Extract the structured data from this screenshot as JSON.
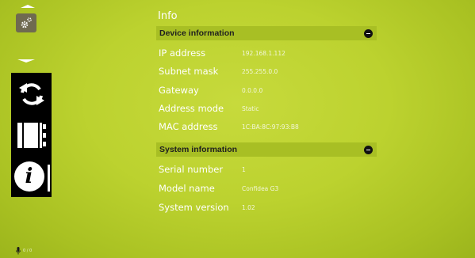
{
  "title": "Info",
  "sidebar": {
    "items": [
      {
        "icon": "gear-icon",
        "selected": false
      },
      {
        "icon": "refresh-icon",
        "selected": false
      },
      {
        "icon": "video-strip-icon",
        "selected": false
      },
      {
        "icon": "info-icon",
        "selected": true
      }
    ]
  },
  "device_section": {
    "label": "Device information",
    "rows": [
      {
        "label": "IP address",
        "value": "192.168.1.112"
      },
      {
        "label": "Subnet mask",
        "value": "255.255.0.0"
      },
      {
        "label": "Gateway",
        "value": "0.0.0.0"
      },
      {
        "label": "Address mode",
        "value": "Static"
      },
      {
        "label": "MAC address",
        "value": "1C:BA:8C:97:93:B8"
      }
    ]
  },
  "system_section": {
    "label": "System information",
    "rows": [
      {
        "label": "Serial number",
        "value": "1"
      },
      {
        "label": "Model name",
        "value": "Confidea G3"
      },
      {
        "label": "System version",
        "value": "1.02"
      }
    ]
  },
  "footer": {
    "mic_count": "0 / 0"
  },
  "colors": {
    "background": "#bcd22f",
    "section_bar": "#a8bf24",
    "side_panel": "#000000",
    "settings_button": "#6f6a50"
  }
}
